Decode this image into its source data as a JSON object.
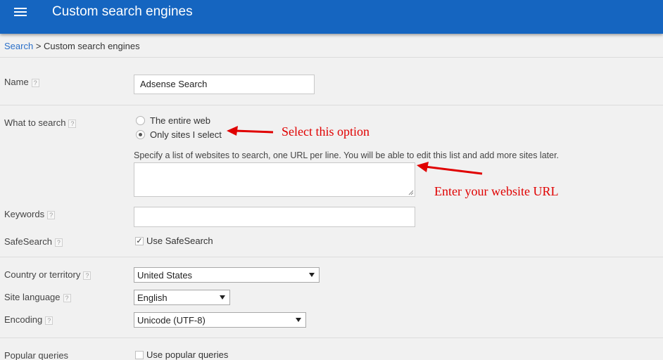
{
  "app": {
    "title": "Custom search engines",
    "menu_icon": "hamburger-menu-icon"
  },
  "breadcrumb": {
    "link": "Search",
    "separator": " > ",
    "current": "Custom search engines"
  },
  "form": {
    "name": {
      "label": "Name",
      "help": "?",
      "value": "Adsense Search"
    },
    "what_to_search": {
      "label": "What to search",
      "help": "?",
      "options": [
        {
          "label": "The entire web",
          "checked": false
        },
        {
          "label": "Only sites I select",
          "checked": true
        }
      ],
      "hint": "Specify a list of websites to search, one URL per line. You will be able to edit this list and add more sites later.",
      "sites_value": ""
    },
    "keywords": {
      "label": "Keywords",
      "help": "?",
      "value": ""
    },
    "safesearch": {
      "label": "SafeSearch",
      "help": "?",
      "checkbox_label": "Use SafeSearch",
      "checked": true,
      "check_mark": "✓"
    },
    "country": {
      "label": "Country or territory",
      "help": "?",
      "selected": "United States"
    },
    "language": {
      "label": "Site language",
      "help": "?",
      "selected": "English"
    },
    "encoding": {
      "label": "Encoding",
      "help": "?",
      "selected": "Unicode (UTF-8)"
    },
    "popular_queries": {
      "label": "Popular queries",
      "checkbox_label": "Use popular queries",
      "checked": false
    }
  },
  "annotations": {
    "select_option": "Select this option",
    "enter_url": "Enter your website URL",
    "color": "#e00000"
  },
  "colors": {
    "header": "#1565c0",
    "link": "#2a6fc9",
    "background": "#f1f1f1"
  }
}
